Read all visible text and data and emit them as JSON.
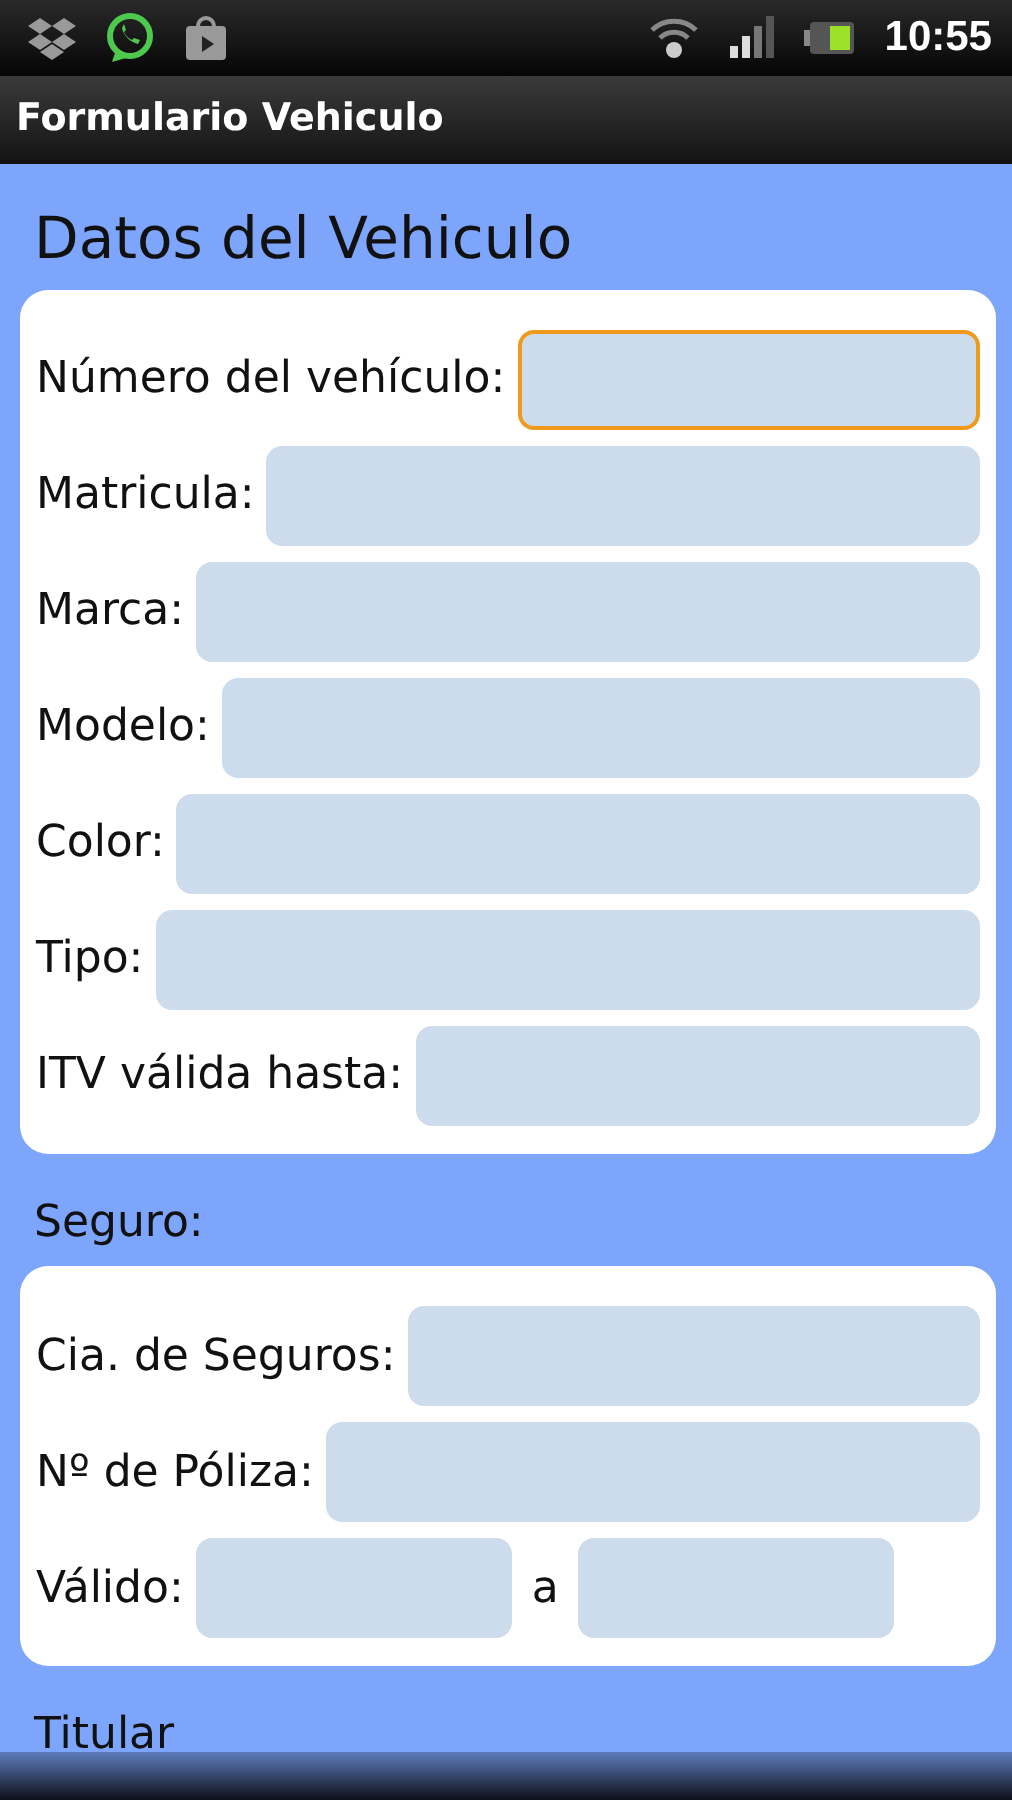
{
  "status_bar": {
    "time": "10:55"
  },
  "window": {
    "title": "Formulario Vehiculo"
  },
  "sections": [
    {
      "title": "Datos del Vehiculo",
      "kind": "heading",
      "fields": [
        {
          "kind": "text",
          "label": "Número del vehículo:",
          "focused": true
        },
        {
          "kind": "text",
          "label": "Matricula:",
          "focused": false
        },
        {
          "kind": "text",
          "label": "Marca:",
          "focused": false
        },
        {
          "kind": "text",
          "label": "Modelo:",
          "focused": false
        },
        {
          "kind": "text",
          "label": "Color:",
          "focused": false
        },
        {
          "kind": "text",
          "label": "Tipo:",
          "focused": false
        },
        {
          "kind": "text",
          "label": "ITV válida hasta:",
          "focused": false
        }
      ]
    },
    {
      "title": "Seguro:",
      "kind": "subheading",
      "fields": [
        {
          "kind": "text",
          "label": "Cia. de Seguros:",
          "focused": false
        },
        {
          "kind": "text",
          "label": "Nº de Póliza:",
          "focused": false
        },
        {
          "kind": "range",
          "label": "Válido:",
          "separator": "a",
          "focused": false
        }
      ]
    },
    {
      "title": "Titular",
      "kind": "subheading"
    }
  ]
}
